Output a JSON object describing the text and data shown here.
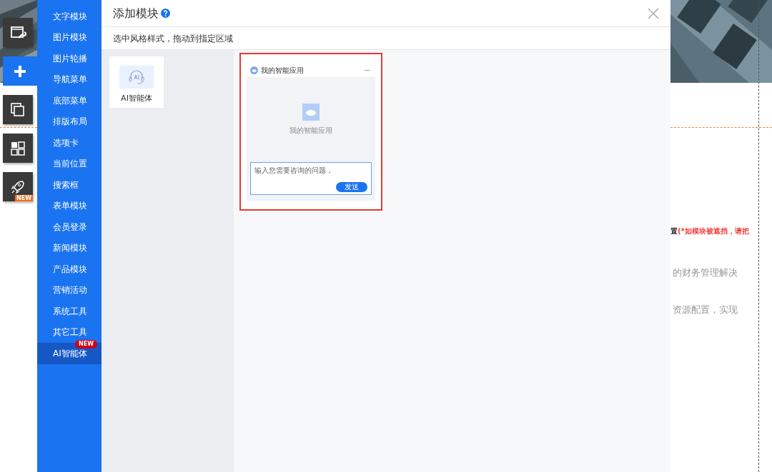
{
  "toolbar": [
    {
      "kind": "site-settings",
      "selected": false
    },
    {
      "kind": "add",
      "selected": true
    },
    {
      "kind": "pages",
      "selected": false
    },
    {
      "kind": "layout",
      "selected": false
    },
    {
      "kind": "publish",
      "selected": false,
      "badge": "NEW"
    }
  ],
  "categories": [
    {
      "label": "文字模块",
      "selected": false
    },
    {
      "label": "图片模块",
      "selected": false
    },
    {
      "label": "图片轮播",
      "selected": false
    },
    {
      "label": "导航菜单",
      "selected": false
    },
    {
      "label": "底部菜单",
      "selected": false
    },
    {
      "label": "排版布局",
      "selected": false
    },
    {
      "label": "选项卡",
      "selected": false
    },
    {
      "label": "当前位置",
      "selected": false
    },
    {
      "label": "搜索框",
      "selected": false
    },
    {
      "label": "表单模块",
      "selected": false
    },
    {
      "label": "会员登录",
      "selected": false
    },
    {
      "label": "新闻模块",
      "selected": false
    },
    {
      "label": "产品模块",
      "selected": false
    },
    {
      "label": "营销活动",
      "selected": false
    },
    {
      "label": "系统工具",
      "selected": false
    },
    {
      "label": "其它工具",
      "selected": false
    },
    {
      "label": "AI智能体",
      "selected": true,
      "badge": "NEW"
    }
  ],
  "dialog": {
    "title": "添加模块",
    "subtitle": "选中风格样式，拖动到指定区域"
  },
  "groups": [
    {
      "label": "AI智能体",
      "selected": true
    }
  ],
  "styles": [
    {
      "kind": "chat",
      "selected": true,
      "header": "我的智能应用",
      "app_name": "我的智能应用",
      "placeholder": "输入您需要咨询的问题，",
      "send": "发送"
    }
  ],
  "background": {
    "notice": "置",
    "warning": "(*如模块被遮挡，请把",
    "lines": [
      "的财务管理解决",
      "资源配置，实现"
    ]
  }
}
